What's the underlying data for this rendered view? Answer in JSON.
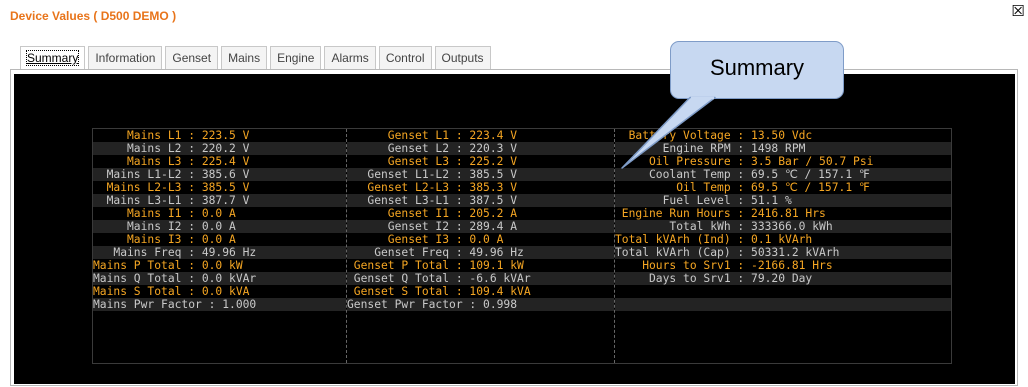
{
  "window": {
    "title": "Device Values ( D500 DEMO )",
    "close_glyph": "☒"
  },
  "tabs": [
    {
      "label": "Summary",
      "active": true
    },
    {
      "label": "Information"
    },
    {
      "label": "Genset"
    },
    {
      "label": "Mains"
    },
    {
      "label": "Engine"
    },
    {
      "label": "Alarms"
    },
    {
      "label": "Control"
    },
    {
      "label": "Outputs"
    }
  ],
  "callout": {
    "text": "Summary"
  },
  "colors": {
    "highlight": "#f5a623",
    "normal": "#c9c9c9",
    "background": "#000000",
    "title": "#e8741a"
  },
  "mains": [
    {
      "text": "     Mains L1 : 223.5 V",
      "hl": true
    },
    {
      "text": "     Mains L2 : 220.2 V",
      "hl": false
    },
    {
      "text": "     Mains L3 : 225.4 V",
      "hl": true
    },
    {
      "text": "  Mains L1-L2 : 385.6 V",
      "hl": false
    },
    {
      "text": "  Mains L2-L3 : 385.5 V",
      "hl": true
    },
    {
      "text": "  Mains L3-L1 : 387.7 V",
      "hl": false
    },
    {
      "text": "     Mains I1 : 0.0 A",
      "hl": true
    },
    {
      "text": "     Mains I2 : 0.0 A",
      "hl": false
    },
    {
      "text": "     Mains I3 : 0.0 A",
      "hl": true
    },
    {
      "text": "   Mains Freq : 49.96 Hz",
      "hl": false
    },
    {
      "text": "Mains P Total : 0.0 kW",
      "hl": true
    },
    {
      "text": "Mains Q Total : 0.0 kVAr",
      "hl": false
    },
    {
      "text": "Mains S Total : 0.0 kVA",
      "hl": true
    },
    {
      "text": "Mains Pwr Factor : 1.000",
      "hl": false
    }
  ],
  "genset": [
    {
      "text": "      Genset L1 : 223.4 V",
      "hl": true
    },
    {
      "text": "      Genset L2 : 220.3 V",
      "hl": false
    },
    {
      "text": "      Genset L3 : 225.2 V",
      "hl": true
    },
    {
      "text": "   Genset L1-L2 : 385.5 V",
      "hl": false
    },
    {
      "text": "   Genset L2-L3 : 385.3 V",
      "hl": true
    },
    {
      "text": "   Genset L3-L1 : 387.5 V",
      "hl": false
    },
    {
      "text": "      Genset I1 : 205.2 A",
      "hl": true
    },
    {
      "text": "      Genset I2 : 289.4 A",
      "hl": false
    },
    {
      "text": "      Genset I3 : 0.0 A",
      "hl": true
    },
    {
      "text": "    Genset Freq : 49.96 Hz",
      "hl": false
    },
    {
      "text": " Genset P Total : 109.1 kW",
      "hl": true
    },
    {
      "text": " Genset Q Total : -6.6 kVAr",
      "hl": false
    },
    {
      "text": " Genset S Total : 109.4 kVA",
      "hl": true
    },
    {
      "text": "Genset Pwr Factor : 0.998",
      "hl": false
    }
  ],
  "engine": [
    {
      "text": "  Battery Voltage : 13.50 Vdc",
      "hl": true
    },
    {
      "text": "       Engine RPM : 1498 RPM",
      "hl": false
    },
    {
      "text": "     Oil Pressure : 3.5 Bar / 50.7 Psi",
      "hl": true
    },
    {
      "text": "     Coolant Temp : 69.5 ℃ / 157.1 ℉",
      "hl": false
    },
    {
      "text": "         Oil Temp : 69.5 ℃ / 157.1 ℉",
      "hl": true
    },
    {
      "text": "       Fuel Level : 51.1 %",
      "hl": false
    },
    {
      "text": " Engine Run Hours : 2416.81 Hrs",
      "hl": true
    },
    {
      "text": "        Total kWh : 333366.0 kWh",
      "hl": false
    },
    {
      "text": "Total kVArh (Ind) : 0.1 kVArh",
      "hl": true
    },
    {
      "text": "Total kVArh (Cap) : 50331.2 kVArh",
      "hl": false
    },
    {
      "text": "    Hours to Srv1 : -2166.81 Hrs",
      "hl": true
    },
    {
      "text": "     Days to Srv1 : 79.20 Day",
      "hl": false
    },
    {
      "text": "",
      "hl": false
    },
    {
      "text": "",
      "hl": false
    }
  ]
}
